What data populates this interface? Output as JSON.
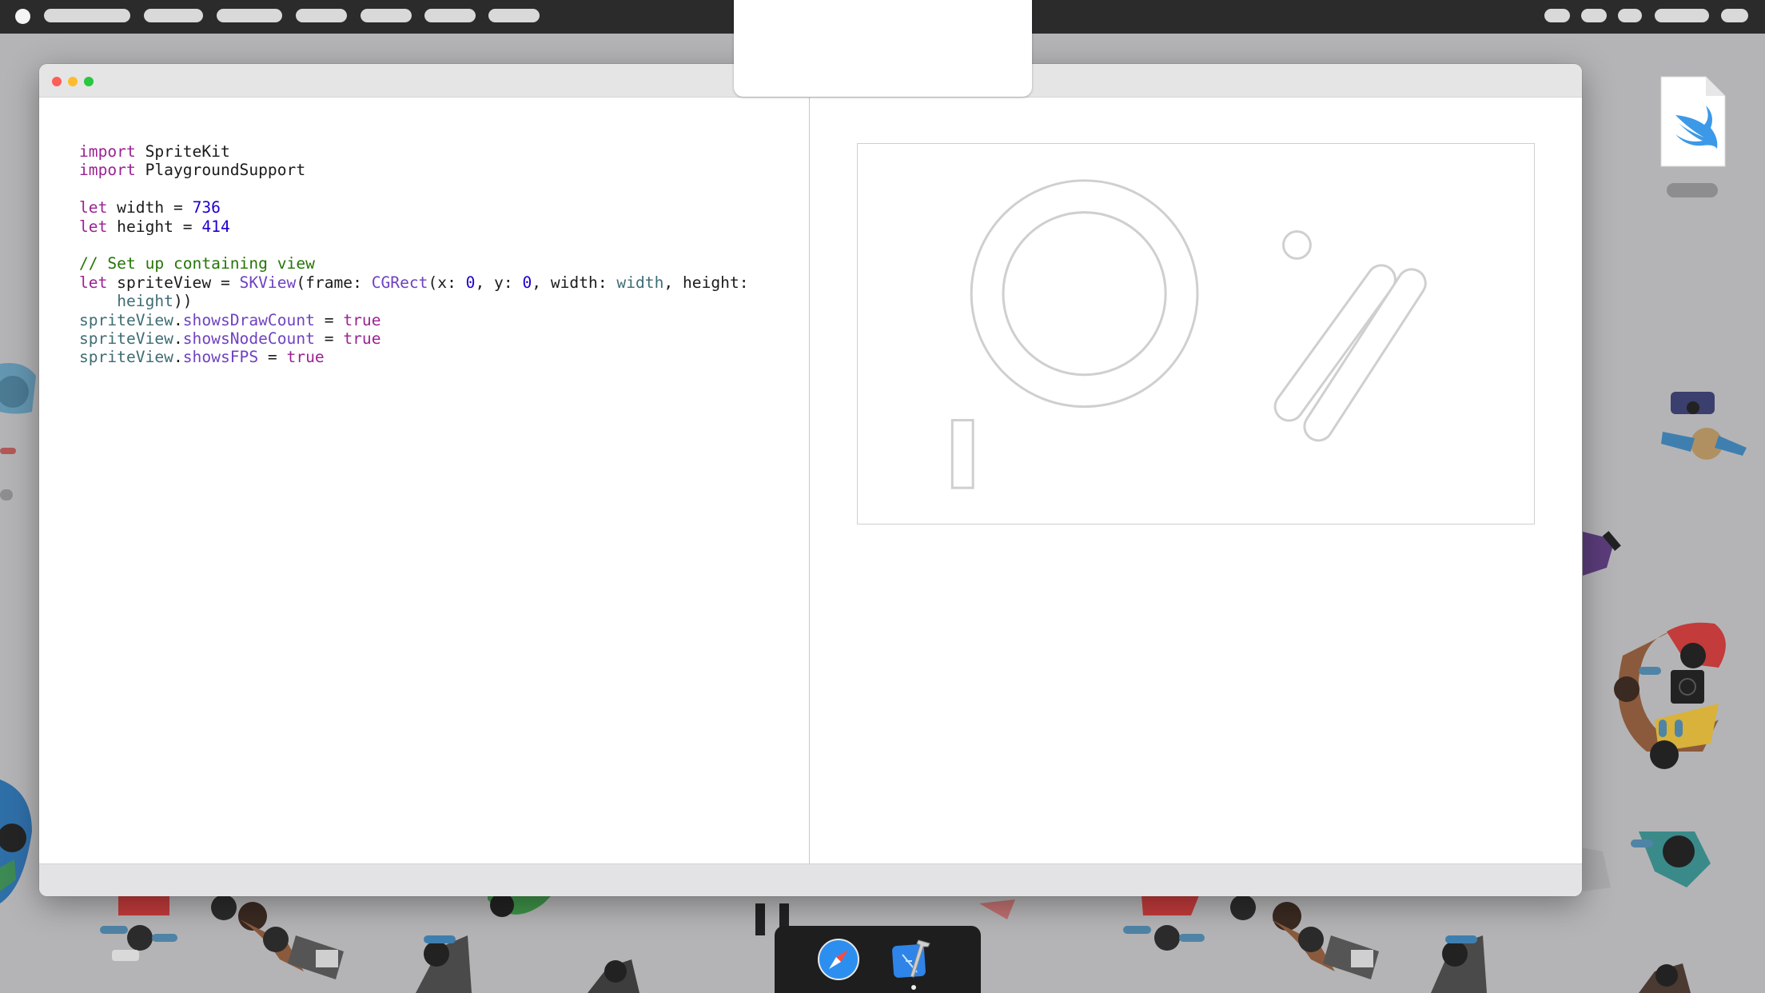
{
  "menubar": {
    "icons": [
      "apple-icon"
    ]
  },
  "desktop": {
    "file_icon": "swift-file-icon"
  },
  "window": {
    "traffic_lights": {
      "close": "#fc5f57",
      "minimize": "#fdbc2e",
      "maximize": "#28c840"
    }
  },
  "editor": {
    "lines": [
      [
        {
          "t": "import",
          "c": "kw"
        },
        {
          "t": " SpriteKit",
          "c": ""
        }
      ],
      [
        {
          "t": "import",
          "c": "kw"
        },
        {
          "t": " PlaygroundSupport",
          "c": ""
        }
      ],
      [],
      [
        {
          "t": "let",
          "c": "kw"
        },
        {
          "t": " width = ",
          "c": ""
        },
        {
          "t": "736",
          "c": "num"
        }
      ],
      [
        {
          "t": "let",
          "c": "kw"
        },
        {
          "t": " height = ",
          "c": ""
        },
        {
          "t": "414",
          "c": "num"
        }
      ],
      [],
      [
        {
          "t": "// Set up containing view",
          "c": "cmt"
        }
      ],
      [
        {
          "t": "let",
          "c": "kw"
        },
        {
          "t": " spriteView = ",
          "c": ""
        },
        {
          "t": "SKView",
          "c": "typ"
        },
        {
          "t": "(frame: ",
          "c": ""
        },
        {
          "t": "CGRect",
          "c": "typ"
        },
        {
          "t": "(x: ",
          "c": ""
        },
        {
          "t": "0",
          "c": "num"
        },
        {
          "t": ", y: ",
          "c": ""
        },
        {
          "t": "0",
          "c": "num"
        },
        {
          "t": ", width: ",
          "c": ""
        },
        {
          "t": "width",
          "c": "prop"
        },
        {
          "t": ", height:",
          "c": ""
        }
      ],
      [
        {
          "t": "    ",
          "c": ""
        },
        {
          "t": "height",
          "c": "prop"
        },
        {
          "t": "))",
          "c": ""
        }
      ],
      [
        {
          "t": "spriteView",
          "c": "prop"
        },
        {
          "t": ".",
          "c": ""
        },
        {
          "t": "showsDrawCount",
          "c": "typ"
        },
        {
          "t": " = ",
          "c": ""
        },
        {
          "t": "true",
          "c": "kw"
        }
      ],
      [
        {
          "t": "spriteView",
          "c": "prop"
        },
        {
          "t": ".",
          "c": ""
        },
        {
          "t": "showsNodeCount",
          "c": "typ"
        },
        {
          "t": " = ",
          "c": ""
        },
        {
          "t": "true",
          "c": "kw"
        }
      ],
      [
        {
          "t": "spriteView",
          "c": "prop"
        },
        {
          "t": ".",
          "c": ""
        },
        {
          "t": "showsFPS",
          "c": "typ"
        },
        {
          "t": " = ",
          "c": ""
        },
        {
          "t": "true",
          "c": "kw"
        }
      ]
    ]
  },
  "dock": {
    "items": [
      "safari-icon",
      "xcode-icon"
    ]
  },
  "colors": {
    "keyword": "#9b2393",
    "number": "#1c00cf",
    "comment": "#267507",
    "type": "#6f42c1",
    "property": "#3e6d74"
  }
}
